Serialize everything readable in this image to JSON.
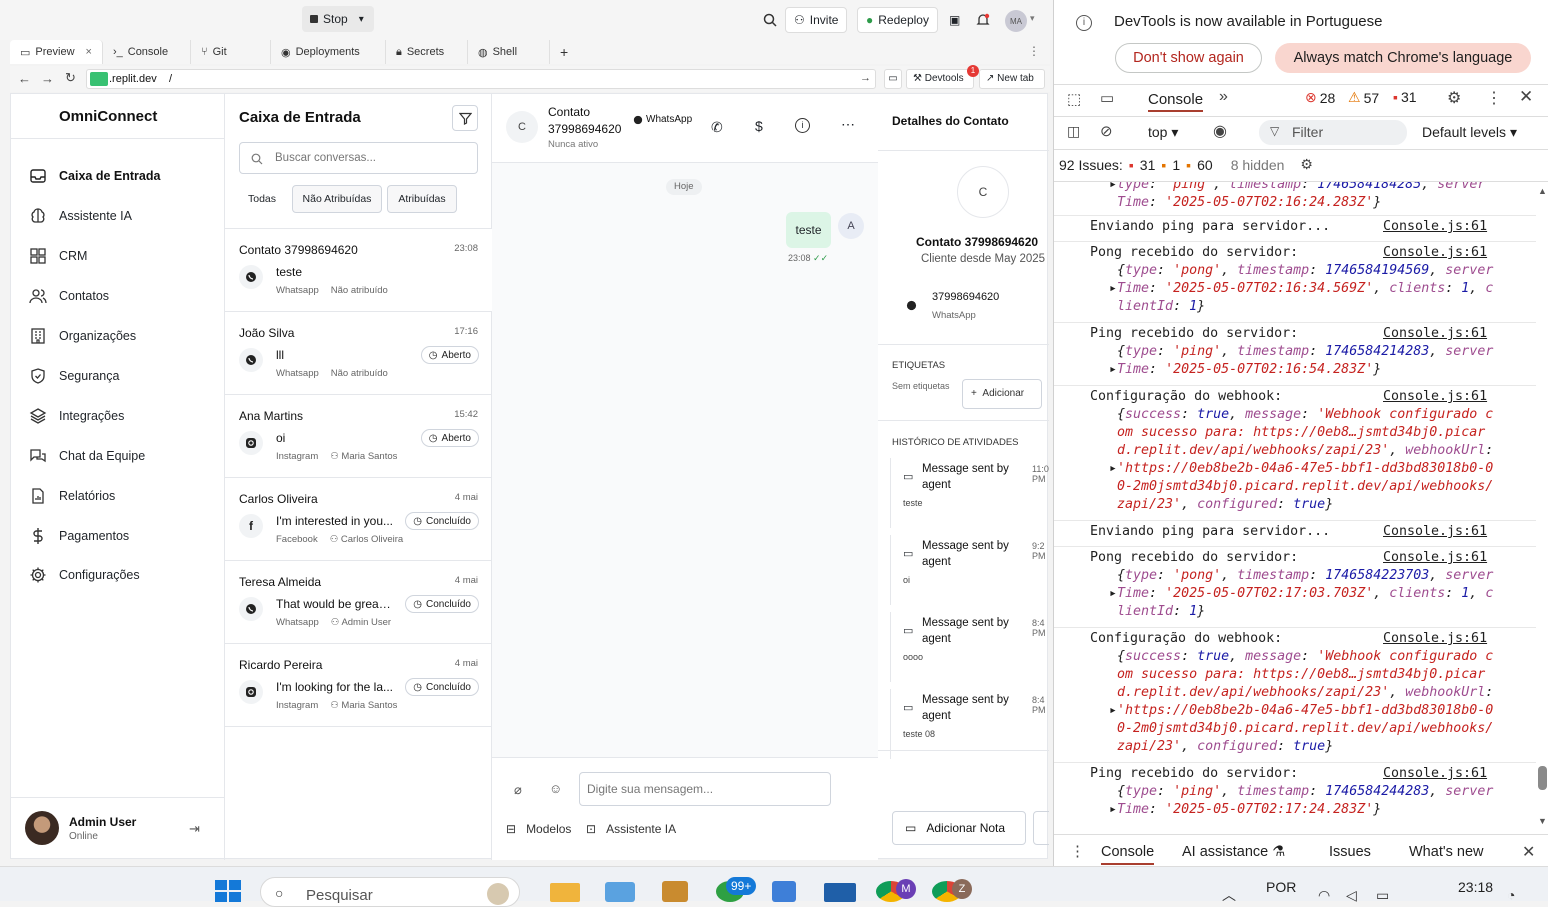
{
  "topbar": {
    "stop": "Stop",
    "invite": "Invite",
    "redeploy": "Redeploy",
    "avatar": "MA"
  },
  "tabs": [
    {
      "label": "Preview",
      "close": "×"
    },
    {
      "label": "Console"
    },
    {
      "label": "Git"
    },
    {
      "label": "Deployments"
    },
    {
      "label": "Secrets"
    },
    {
      "label": "Shell"
    }
  ],
  "urlbar": {
    "domain": ".replit.dev",
    "path": "/",
    "devtools": "Devtools",
    "devtools_badge": "1",
    "newtab": "New tab"
  },
  "sidebar": {
    "app_name": "OmniConnect",
    "items": [
      {
        "label": "Caixa de Entrada",
        "icon": "inbox-icon"
      },
      {
        "label": "Assistente IA",
        "icon": "brain-icon"
      },
      {
        "label": "CRM",
        "icon": "grid-icon"
      },
      {
        "label": "Contatos",
        "icon": "users-icon"
      },
      {
        "label": "Organizações",
        "icon": "building-icon"
      },
      {
        "label": "Segurança",
        "icon": "shield-icon"
      },
      {
        "label": "Integrações",
        "icon": "layers-icon"
      },
      {
        "label": "Chat da Equipe",
        "icon": "chat-icon"
      },
      {
        "label": "Relatórios",
        "icon": "report-icon"
      },
      {
        "label": "Pagamentos",
        "icon": "dollar-icon"
      },
      {
        "label": "Configurações",
        "icon": "gear-icon"
      }
    ],
    "user": {
      "name": "Admin User",
      "status": "Online"
    }
  },
  "inbox": {
    "title": "Caixa de Entrada",
    "search_placeholder": "Buscar conversas...",
    "filters": [
      "Todas",
      "Não Atribuídas",
      "Atribuídas"
    ],
    "conversations": [
      {
        "name": "Contato 37998694620",
        "time": "23:08",
        "message": "teste",
        "channel": "Whatsapp",
        "assignee": "Não atribuído",
        "status": ""
      },
      {
        "name": "João Silva",
        "time": "17:16",
        "message": "lll",
        "channel": "Whatsapp",
        "assignee": "Não atribuído",
        "status": "Aberto"
      },
      {
        "name": "Ana Martins",
        "time": "15:42",
        "message": "oi",
        "channel": "Instagram",
        "assignee": "Maria Santos",
        "status": "Aberto"
      },
      {
        "name": "Carlos Oliveira",
        "time": "4 mai",
        "message": "I'm interested in you...",
        "channel": "Facebook",
        "assignee": "Carlos Oliveira",
        "status": "Concluído"
      },
      {
        "name": "Teresa Almeida",
        "time": "4 mai",
        "message": "That would be great!...",
        "channel": "Whatsapp",
        "assignee": "Admin User",
        "status": "Concluído"
      },
      {
        "name": "Ricardo Pereira",
        "time": "4 mai",
        "message": "I'm looking for the la...",
        "channel": "Instagram",
        "assignee": "Maria Santos",
        "status": "Concluído"
      }
    ]
  },
  "chat": {
    "avatar": "C",
    "contact": "Contato",
    "contact_number": "37998694620",
    "channel": "WhatsApp",
    "status": "Nunca ativo",
    "day": "Hoje",
    "messages": [
      {
        "text": "teste",
        "time": "23:08",
        "avatar": "A"
      }
    ],
    "input_placeholder": "Digite sua mensagem...",
    "templates": "Modelos",
    "assistant": "Assistente IA"
  },
  "details": {
    "title": "Detalhes do Contato",
    "avatar": "C",
    "name": "Contato 37998694620",
    "since": "Cliente desde May 2025",
    "phone": "37998694620",
    "phone_channel": "WhatsApp",
    "tags_title": "ETIQUETAS",
    "no_tags": "Sem etiquetas",
    "add": "Adicionar",
    "history_title": "HISTÓRICO DE ATIVIDADES",
    "activities": [
      {
        "title": "Message sent by agent",
        "body": "teste",
        "time": "11:0 PM"
      },
      {
        "title": "Message sent by agent",
        "body": "oi",
        "time": "9:2 PM"
      },
      {
        "title": "Message sent by agent",
        "body": "oooo",
        "time": "8:4 PM"
      },
      {
        "title": "Message sent by agent",
        "body": "teste 08",
        "time": "8:4 PM"
      }
    ],
    "add_note": "Adicionar Nota"
  },
  "devtools": {
    "banner": "DevTools is now available in Portuguese",
    "dont_show": "Don't show again",
    "always_match": "Always match Chrome's language",
    "panel_tab": "Console",
    "errors": "28",
    "warnings": "57",
    "infos": "31",
    "context": "top",
    "filter_placeholder": "Filter",
    "levels": "Default levels",
    "issues_label": "92 Issues:",
    "issues_errors": "31",
    "issues_warnings": "1",
    "issues_infos": "60",
    "hidden": "8 hidden",
    "source": "Console.js:61",
    "drawer_tabs": [
      "Console",
      "AI assistance",
      "Issues",
      "What's new"
    ]
  },
  "taskbar": {
    "search": "Pesquisar",
    "lang": "POR",
    "time": "23:18",
    "chrome_badge": "99+"
  }
}
